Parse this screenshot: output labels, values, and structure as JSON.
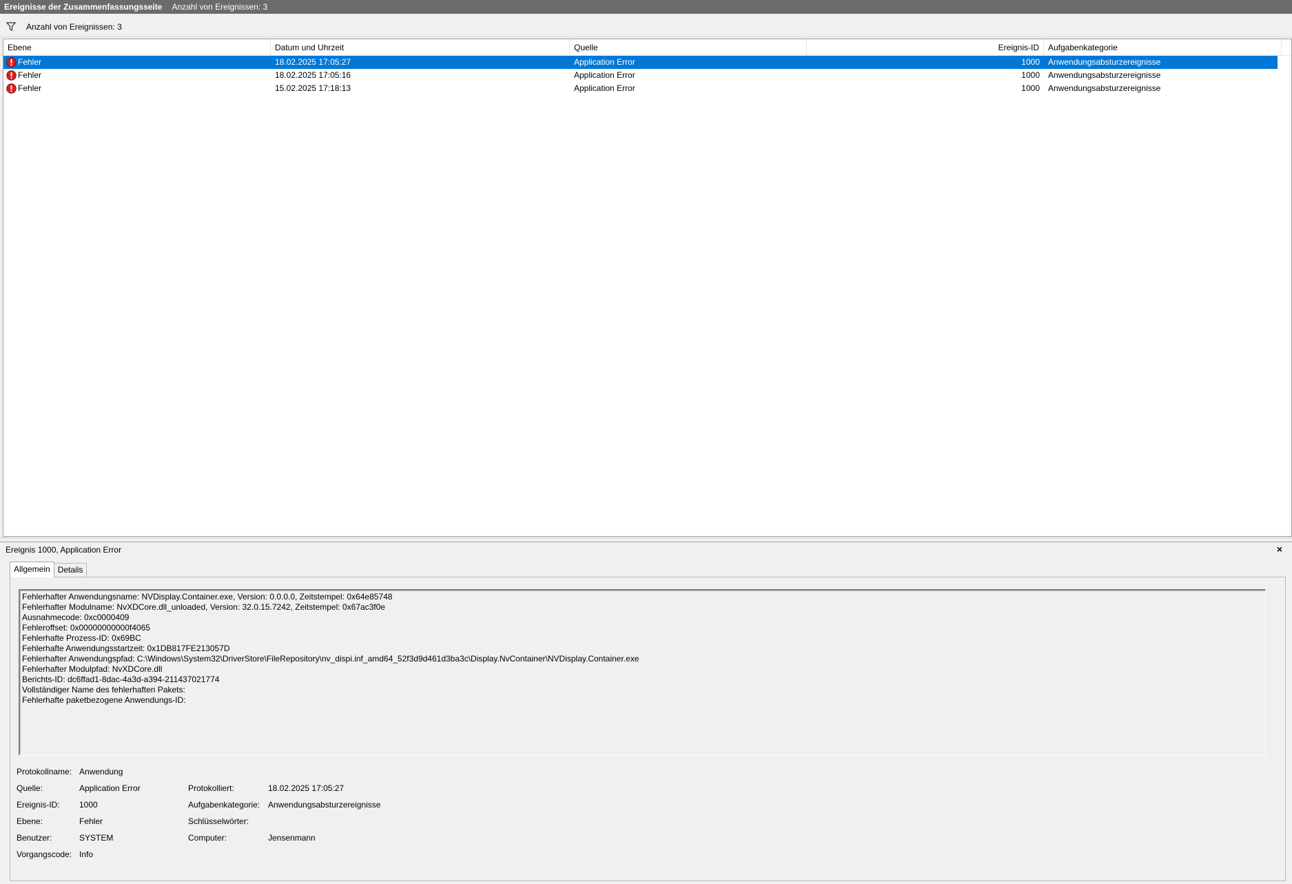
{
  "titlebar": {
    "title": "Ereignisse der Zusammenfassungsseite",
    "count": "Anzahl von Ereignissen: 3"
  },
  "filterbar": {
    "icon": "filter-icon",
    "text": "Anzahl von Ereignissen: 3"
  },
  "list": {
    "columns": [
      "Ebene",
      "Datum und Uhrzeit",
      "Quelle",
      "Ereignis-ID",
      "Aufgabenkategorie"
    ],
    "rows": [
      {
        "level": "Fehler",
        "datetime": "18.02.2025 17:05:27",
        "source": "Application Error",
        "id": "1000",
        "category": "Anwendungsabsturzereignisse"
      },
      {
        "level": "Fehler",
        "datetime": "18.02.2025 17:05:16",
        "source": "Application Error",
        "id": "1000",
        "category": "Anwendungsabsturzereignisse"
      },
      {
        "level": "Fehler",
        "datetime": "15.02.2025 17:18:13",
        "source": "Application Error",
        "id": "1000",
        "category": "Anwendungsabsturzereignisse"
      }
    ],
    "selected_row": 0,
    "colors": {
      "selected": "#0078d7",
      "error_icon": "#d21f1f"
    }
  },
  "detail": {
    "title": "Ereignis 1000, Application Error",
    "close": "×",
    "tabs": [
      "Allgemein",
      "Details"
    ],
    "message": [
      "Fehlerhafter Anwendungsname: NVDisplay.Container.exe, Version: 0.0.0.0, Zeitstempel: 0x64e85748",
      "Fehlerhafter Modulname: NvXDCore.dll_unloaded, Version: 32.0.15.7242, Zeitstempel: 0x67ac3f0e",
      "Ausnahmecode: 0xc0000409",
      "Fehleroffset: 0x00000000000f4065",
      "Fehlerhafte Prozess-ID: 0x69BC",
      "Fehlerhafte Anwendungsstartzeit: 0x1DB817FE213057D",
      "Fehlerhafter Anwendungspfad: C:\\Windows\\System32\\DriverStore\\FileRepository\\nv_dispi.inf_amd64_52f3d9d461d3ba3c\\Display.NvContainer\\NVDisplay.Container.exe",
      "Fehlerhafter Modulpfad: NvXDCore.dll",
      "Berichts-ID: dc6ffad1-8dac-4a3d-a394-211437021774",
      "Vollständiger Name des fehlerhaften Pakets:",
      "Fehlerhafte paketbezogene Anwendungs-ID:"
    ],
    "props": {
      "protokollname_label": "Protokollname:",
      "protokollname_value": "Anwendung",
      "quelle_label": "Quelle:",
      "quelle_value": "Application Error",
      "protokolliert_label": "Protokolliert:",
      "protokolliert_value": "18.02.2025 17:05:27",
      "ereignis_id_label": "Ereignis-ID:",
      "ereignis_id_value": "1000",
      "aufgabenkategorie_label": "Aufgabenkategorie:",
      "aufgabenkategorie_value": "Anwendungsabsturzereignisse",
      "ebene_label": "Ebene:",
      "ebene_value": "Fehler",
      "schluesselwoerter_label": "Schlüsselwörter:",
      "schluesselwoerter_value": "",
      "benutzer_label": "Benutzer:",
      "benutzer_value": "SYSTEM",
      "computer_label": "Computer:",
      "computer_value": "Jensenmann",
      "vorgangscode_label": "Vorgangscode:",
      "vorgangscode_value": "Info"
    }
  }
}
